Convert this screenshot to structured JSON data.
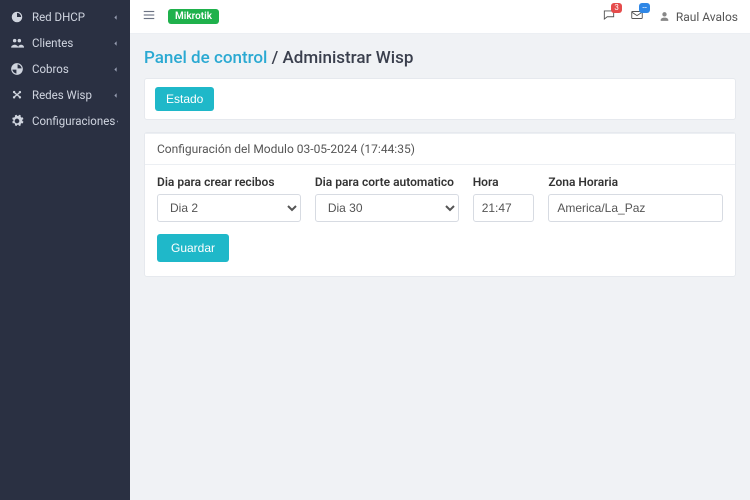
{
  "sidebar": {
    "items": [
      {
        "label": "Red DHCP",
        "icon": "dashboard-icon"
      },
      {
        "label": "Clientes",
        "icon": "users-icon"
      },
      {
        "label": "Cobros",
        "icon": "chart-icon"
      },
      {
        "label": "Redes Wisp",
        "icon": "network-icon"
      },
      {
        "label": "Configuraciones",
        "icon": "gear-icon"
      }
    ]
  },
  "topbar": {
    "brand_badge": "Mikrotik",
    "notif1_count": "3",
    "notif2_count": "--",
    "user_name": "Raul Avalos"
  },
  "breadcrumb": {
    "root": "Panel de control",
    "sep": " / ",
    "current": "Administrar Wisp"
  },
  "status_button": "Estado",
  "module_config_text": "Configuración del Modulo 03-05-2024 (17:44:35)",
  "form": {
    "recibos_label": "Dia para crear recibos",
    "recibos_value": "Dia 2",
    "corte_label": "Dia para corte automatico",
    "corte_value": "Dia 30",
    "hora_label": "Hora",
    "hora_value": "21:47",
    "zona_label": "Zona Horaria",
    "zona_value": "America/La_Paz",
    "save_label": "Guardar"
  }
}
